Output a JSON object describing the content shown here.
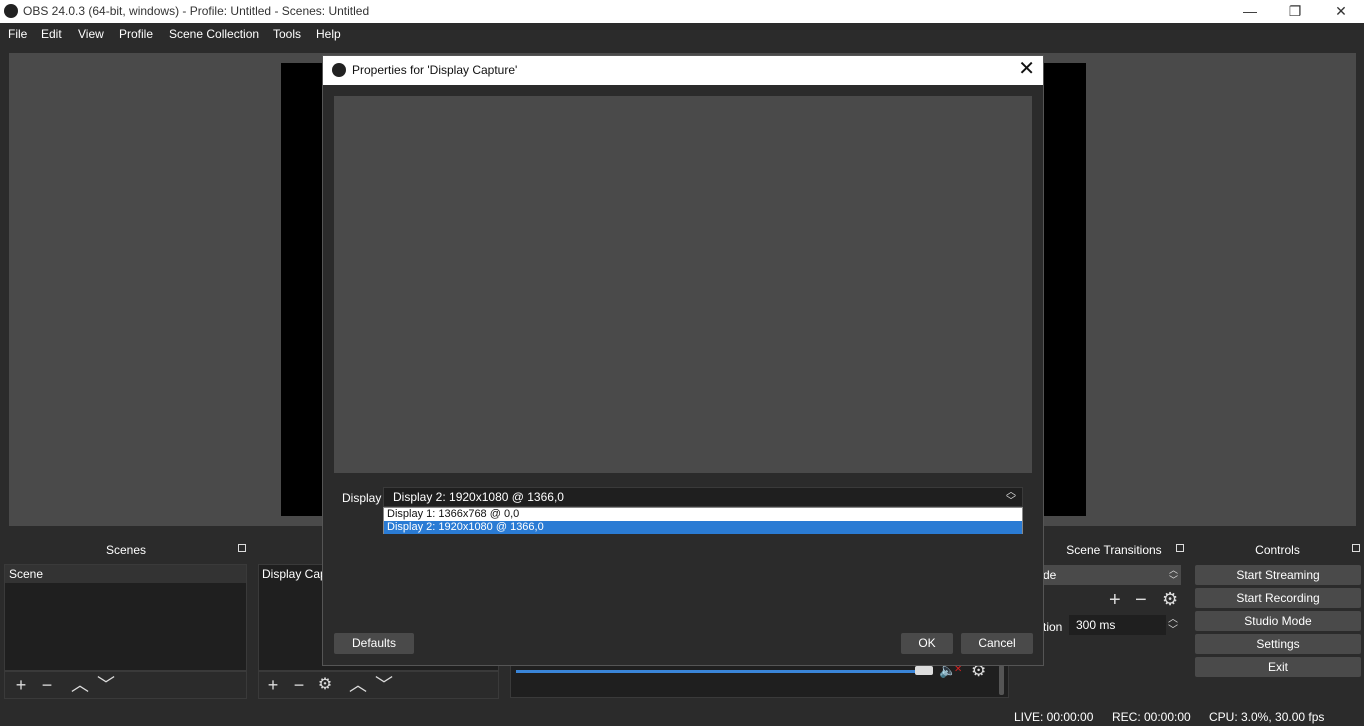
{
  "window": {
    "title": "OBS 24.0.3 (64-bit, windows) - Profile: Untitled - Scenes: Untitled",
    "minimize": "—",
    "restore": "❐",
    "close": "✕"
  },
  "menu": [
    "File",
    "Edit",
    "View",
    "Profile",
    "Scene Collection",
    "Tools",
    "Help"
  ],
  "docks": {
    "scenes": {
      "title": "Scenes",
      "items": [
        "Scene"
      ]
    },
    "sources": {
      "items": [
        "Display Capt"
      ]
    },
    "transitions": {
      "title": "Scene Transitions",
      "mode_partial": "de",
      "duration_label_partial": "tion",
      "duration_value": "300 ms"
    },
    "controls": {
      "title": "Controls",
      "buttons": [
        "Start Streaming",
        "Start Recording",
        "Studio Mode",
        "Settings",
        "Exit"
      ]
    }
  },
  "status": {
    "live": "LIVE: 00:00:00",
    "rec": "REC: 00:00:00",
    "cpu": "CPU: 3.0%, 30.00 fps"
  },
  "dialog": {
    "title": "Properties for 'Display Capture'",
    "display_label": "Display",
    "display_value": "Display 2: 1920x1080 @ 1366,0",
    "options": [
      "Display 1: 1366x768 @ 0,0",
      "Display 2: 1920x1080 @ 1366,0"
    ],
    "selected_option_index": 1,
    "defaults_label": "Defaults",
    "ok_label": "OK",
    "cancel_label": "Cancel"
  },
  "icons": {
    "add": "+",
    "remove": "−",
    "up": "︿",
    "down": "﹀",
    "gear": "⚙"
  },
  "colors": {
    "background": "#2b2b2b",
    "panel": "#4a4a4a",
    "selection": "#2a7bd4",
    "volume": "#3a85d8",
    "muted": "#d42020"
  }
}
